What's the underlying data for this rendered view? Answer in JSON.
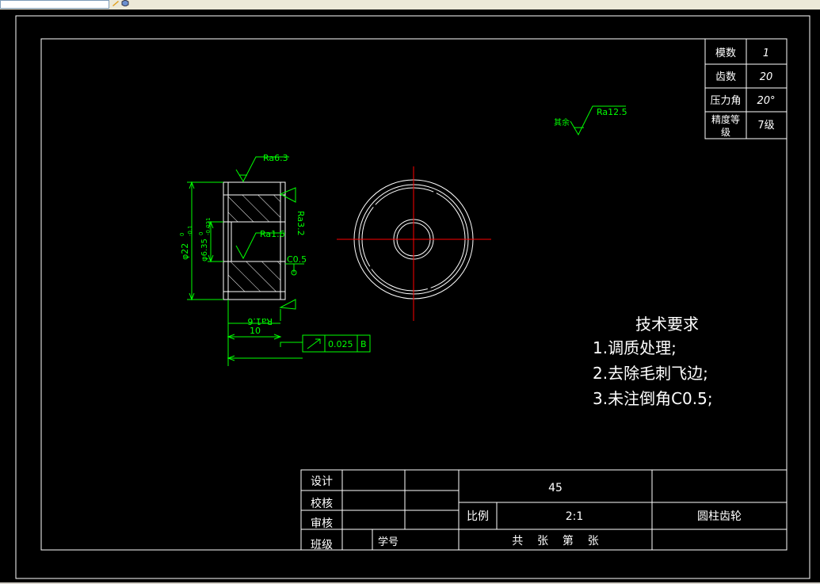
{
  "parameters_table": {
    "rows": [
      {
        "label": "模数",
        "value": "1"
      },
      {
        "label": "齿数",
        "value": "20"
      },
      {
        "label": "压力角",
        "value": "20°"
      },
      {
        "label_line1": "精度等",
        "label_line2": "级",
        "value": "7级"
      }
    ]
  },
  "surface_marks": {
    "general_prefix": "其余",
    "general": "Ra12.5",
    "top": "Ra6.3",
    "right_face": "Ra3.2",
    "bore": "Ra1.6",
    "bottom": "Ra1.6"
  },
  "dimensions": {
    "outer_diameter": "φ22",
    "outer_tol_upper": "0",
    "outer_tol_lower": "-0.1",
    "bore_diameter": "φ6.35",
    "bore_tol_upper": "0",
    "bore_tol_lower": "-0.021",
    "chamfer": "C0.5",
    "width": "10"
  },
  "tolerance_frame": {
    "symbol": "↗",
    "value": "0.025",
    "datum": "B"
  },
  "tech_requirements": {
    "title": "技术要求",
    "items": [
      "1.调质处理;",
      "2.去除毛刺飞边;",
      "3.未注倒角C0.5;"
    ]
  },
  "title_block": {
    "designer_label": "设计",
    "checker_label": "校核",
    "reviewer_label": "审核",
    "class_label": "班级",
    "student_no_label": "学号",
    "material": "45",
    "scale_label": "比例",
    "scale": "2:1",
    "sheet_text": "共    张    第    张",
    "part_name": "圆柱齿轮"
  },
  "colors": {
    "background": "#000000",
    "drawing_lines": "#ffffff",
    "dimensions": "#00ff00",
    "center_lines": "#ff0000",
    "text": "#ffffff"
  }
}
